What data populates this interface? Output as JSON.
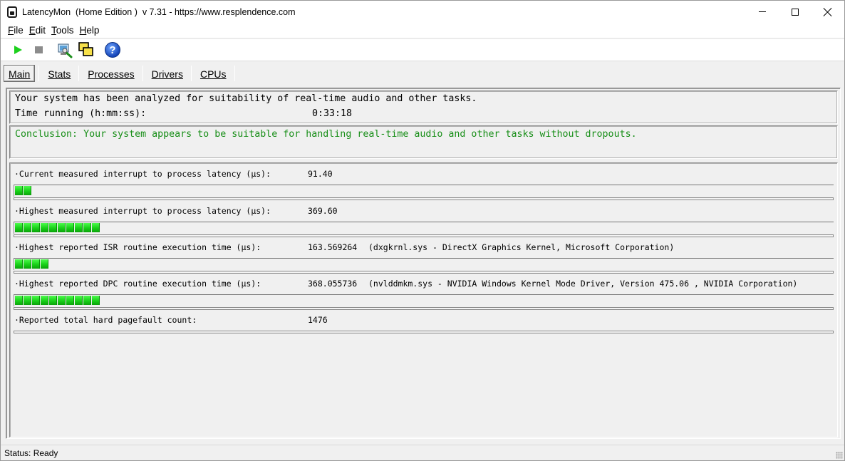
{
  "window": {
    "title": "LatencyMon  (Home Edition )  v 7.31 - https://www.resplendence.com"
  },
  "menu": [
    {
      "accel": "F",
      "rest": "ile"
    },
    {
      "accel": "E",
      "rest": "dit"
    },
    {
      "accel": "T",
      "rest": "ools"
    },
    {
      "accel": "H",
      "rest": "elp"
    }
  ],
  "toolbar": {
    "icons": [
      "play-icon",
      "stop-icon",
      "driver-tool-icon",
      "windows-icon",
      "help-icon"
    ]
  },
  "tabs": [
    {
      "label": "Main",
      "active": true
    },
    {
      "label": "Stats",
      "active": false
    },
    {
      "label": "Processes",
      "active": false
    },
    {
      "label": "Drivers",
      "active": false
    },
    {
      "label": "CPUs",
      "active": false
    }
  ],
  "summary": {
    "line1": "Your system has been analyzed for suitability of real-time audio and other tasks.",
    "time_label": "Time running (h:mm:ss):",
    "time_value": "0:33:18",
    "conclusion": "Conclusion: Your system appears to be suitable for handling real-time audio and other tasks without dropouts.",
    "conclusion_color": "#178e17"
  },
  "metrics": [
    {
      "label": "·Current measured interrupt to process latency (µs):",
      "value": "91.40",
      "extra": "",
      "segments": 2
    },
    {
      "label": "·Highest measured interrupt to process latency (µs):",
      "value": "369.60",
      "extra": "",
      "segments": 10
    },
    {
      "label": "·Highest reported ISR routine execution time (µs):",
      "value": "163.569264",
      "extra": "(dxgkrnl.sys - DirectX Graphics Kernel, Microsoft Corporation)",
      "segments": 4
    },
    {
      "label": "·Highest reported DPC routine execution time (µs):",
      "value": "368.055736",
      "extra": "(nvlddmkm.sys - NVIDIA Windows Kernel Mode Driver, Version 475.06 , NVIDIA Corporation)",
      "segments": 10
    },
    {
      "label": "·Reported total hard pagefault count:",
      "value": "1476",
      "extra": "",
      "segments": 0
    }
  ],
  "status": {
    "text": "Status: Ready"
  }
}
